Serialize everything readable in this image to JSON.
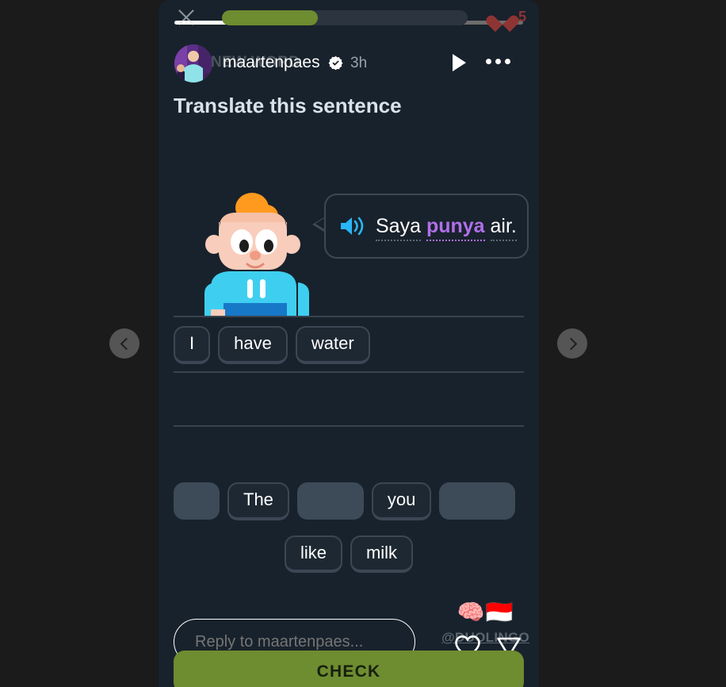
{
  "story": {
    "progress_segments": [
      {
        "fill_percent": 100
      },
      {
        "fill_percent": 38
      }
    ],
    "close_label": "Close",
    "lesson_progress_percent": 39,
    "hearts_count": "5",
    "author": {
      "username": "maartenpaes",
      "verified": true,
      "time_ago": "3h",
      "ghost_label": "NEW WORD"
    },
    "play_label": "Play",
    "more_label": "More options"
  },
  "lesson": {
    "prompt_title": "Translate this sentence",
    "sentence": {
      "tokens": [
        {
          "text": "Saya",
          "highlight": false
        },
        {
          "text": "punya",
          "highlight": true
        },
        {
          "text": "air.",
          "highlight": false
        }
      ],
      "highlight_color": "#b06fe8"
    },
    "answer_lines": [
      {
        "tiles": [
          "I",
          "have",
          "water"
        ]
      },
      {
        "tiles": []
      }
    ],
    "word_bank": {
      "row1": [
        {
          "label": "",
          "used": true
        },
        {
          "label": "The",
          "used": false
        },
        {
          "label": "",
          "used": true
        },
        {
          "label": "you",
          "used": false
        },
        {
          "label": "",
          "used": true
        }
      ],
      "row2": [
        {
          "label": "like",
          "used": false
        },
        {
          "label": "milk",
          "used": false
        }
      ]
    },
    "check_button": "CHECK"
  },
  "reply": {
    "placeholder": "Reply to maartenpaes...",
    "like_label": "Like",
    "send_label": "Send"
  },
  "watermark": {
    "emojis": "🧠🇮🇩",
    "handle": "@DUOLINGO"
  },
  "navigation": {
    "prev_label": "Previous story",
    "next_label": "Next story"
  },
  "colors": {
    "card_bg": "#18222c",
    "accent_green": "#6e8c30",
    "heart_red": "#8e3434",
    "tile_border": "#3b4754"
  }
}
